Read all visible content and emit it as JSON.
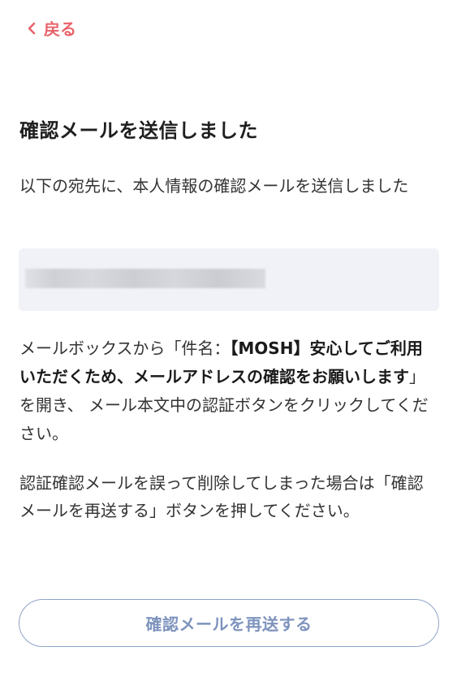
{
  "header": {
    "back_label": "戻る",
    "back_icon": "chevron-left-icon",
    "accent_color": "#e8636b"
  },
  "main": {
    "title": "確認メールを送信しました",
    "intro": "以下の宛先に、本人情報の確認メールを送信しました",
    "email_value": "(redacted email address)",
    "instructions": {
      "part1": "メールボックスから「件名：",
      "subject": "【MOSH】安心してご利用いただくため、メールアドレスの確認をお願いします",
      "part2": "」を開き、 メール本文中の認証ボタンをクリックしてください。"
    },
    "note": "認証確認メールを誤って削除してしまった場合は「確認メールを再送する」ボタンを押してください。"
  },
  "actions": {
    "resend_label": "確認メールを再送する",
    "resend_color": "#7e93bd"
  }
}
